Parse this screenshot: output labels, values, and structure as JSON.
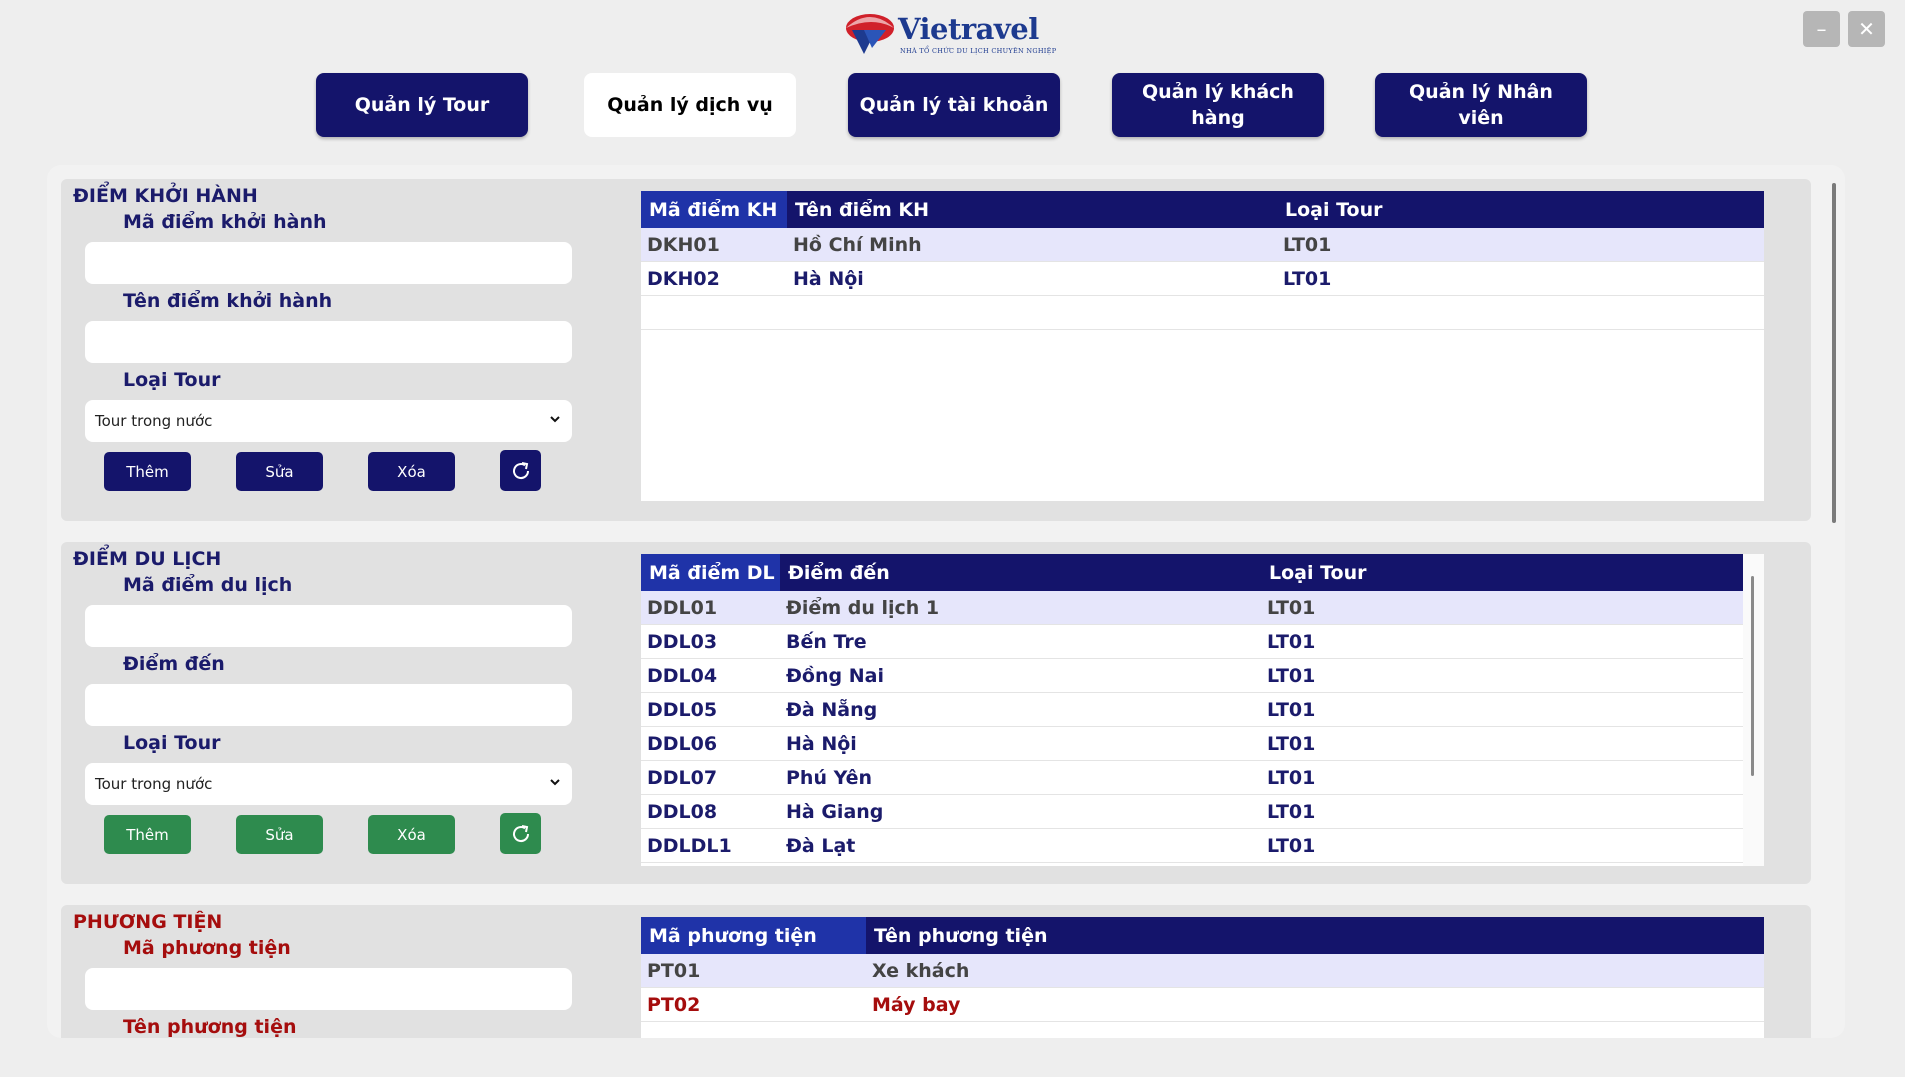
{
  "brand": {
    "name": "Vietravel",
    "tagline": "NHÀ TỔ CHỨC DU LỊCH CHUYÊN NGHIỆP",
    "colors": {
      "navy": "#14146b",
      "brand_blue": "#1d3a8f",
      "logo_red": "#d0202a",
      "green": "#2e8b4e",
      "red_text": "#a50d0d"
    }
  },
  "window": {
    "minimize_label": "–",
    "close_label": "✕"
  },
  "nav": [
    {
      "label": "Quản lý Tour",
      "active": false
    },
    {
      "label": "Quản lý dịch vụ",
      "active": true
    },
    {
      "label": "Quản lý tài khoản",
      "active": false
    },
    {
      "label": "Quản lý khách hàng",
      "active": false
    },
    {
      "label": "Quản lý Nhân viên",
      "active": false
    }
  ],
  "sections": {
    "departure": {
      "title": "ĐIỂM KHỞI HÀNH",
      "field1_label": "Mã điểm khởi hành",
      "field1_value": "",
      "field2_label": "Tên điểm khởi hành",
      "field2_value": "",
      "field3_label": "Loại Tour",
      "select_value": "Tour trong nước",
      "buttons": {
        "add": "Thêm",
        "edit": "Sửa",
        "delete": "Xóa",
        "refresh_icon": "refresh-icon"
      },
      "columns": [
        "Mã điểm KH",
        "Tên điểm KH",
        "Loại Tour"
      ],
      "rows": [
        [
          "DKH01",
          "Hồ Chí Minh",
          "LT01"
        ],
        [
          "DKH02",
          "Hà Nội",
          "LT01"
        ]
      ]
    },
    "destination": {
      "title": "ĐIỂM DU LỊCH",
      "field1_label": "Mã điểm du lịch",
      "field1_value": "",
      "field2_label": "Điểm đến",
      "field2_value": "",
      "field3_label": "Loại Tour",
      "select_value": "Tour trong nước",
      "buttons": {
        "add": "Thêm",
        "edit": "Sửa",
        "delete": "Xóa",
        "refresh_icon": "refresh-icon"
      },
      "columns": [
        "Mã điểm DL",
        "Điểm đến",
        "Loại Tour"
      ],
      "rows": [
        [
          "DDL01",
          "Điểm du lịch 1",
          "LT01"
        ],
        [
          "DDL03",
          "Bến Tre",
          "LT01"
        ],
        [
          "DDL04",
          "Đồng Nai",
          "LT01"
        ],
        [
          "DDL05",
          "Đà Nẵng",
          "LT01"
        ],
        [
          "DDL06",
          "Hà Nội",
          "LT01"
        ],
        [
          "DDL07",
          "Phú Yên",
          "LT01"
        ],
        [
          "DDL08",
          "Hà Giang",
          "LT01"
        ],
        [
          "DDLDL1",
          "Đà Lạt",
          "LT01"
        ]
      ]
    },
    "vehicle": {
      "title": "PHƯƠNG TIỆN",
      "field1_label": "Mã phương tiện",
      "field1_value": "",
      "field2_label": "Tên phương tiện",
      "columns": [
        "Mã phương tiện",
        "Tên phương tiện"
      ],
      "rows": [
        [
          "PT01",
          "Xe khách"
        ],
        [
          "PT02",
          "Máy bay"
        ]
      ]
    }
  }
}
